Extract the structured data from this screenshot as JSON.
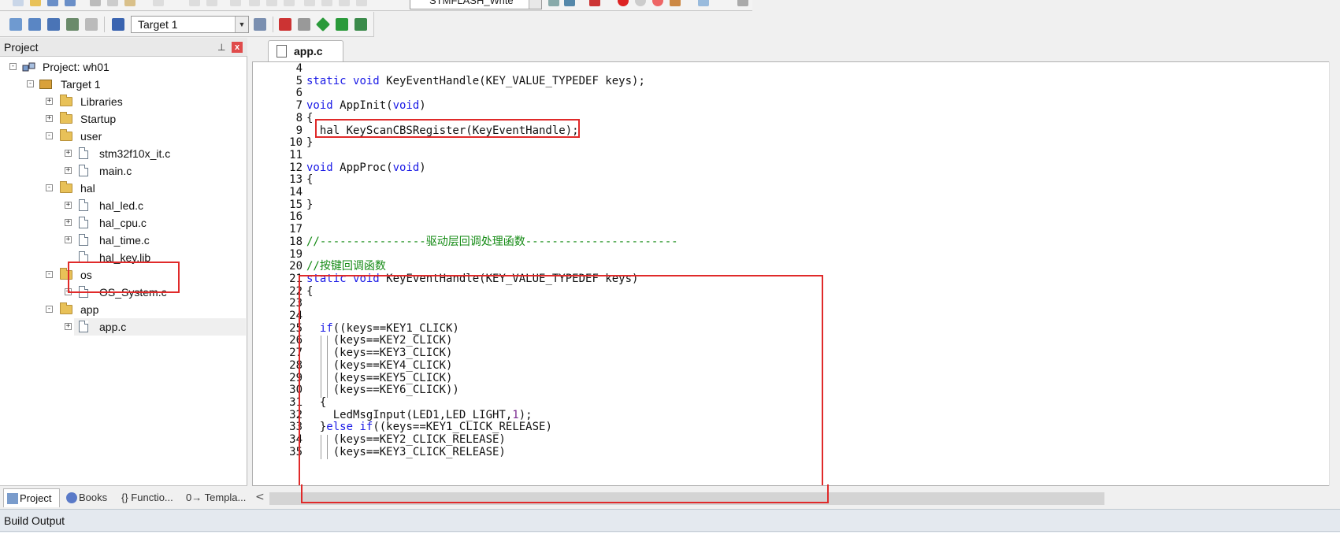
{
  "toolbar": {
    "flash_combo": "STMFLASH_Write",
    "target_combo": "Target 1"
  },
  "project_panel": {
    "title": "Project",
    "tree": [
      {
        "label": "Project: wh01",
        "level": 0,
        "kind": "project",
        "expanded": true
      },
      {
        "label": "Target 1",
        "level": 1,
        "kind": "target",
        "expanded": true
      },
      {
        "label": "Libraries",
        "level": 2,
        "kind": "folder",
        "expanded": false
      },
      {
        "label": "Startup",
        "level": 2,
        "kind": "folder",
        "expanded": false
      },
      {
        "label": "user",
        "level": 2,
        "kind": "folder",
        "expanded": true
      },
      {
        "label": "stm32f10x_it.c",
        "level": 3,
        "kind": "file"
      },
      {
        "label": "main.c",
        "level": 3,
        "kind": "file"
      },
      {
        "label": "hal",
        "level": 2,
        "kind": "folder",
        "expanded": true
      },
      {
        "label": "hal_led.c",
        "level": 3,
        "kind": "file"
      },
      {
        "label": "hal_cpu.c",
        "level": 3,
        "kind": "file"
      },
      {
        "label": "hal_time.c",
        "level": 3,
        "kind": "file"
      },
      {
        "label": "hal_key.lib",
        "level": 3,
        "kind": "file"
      },
      {
        "label": "os",
        "level": 2,
        "kind": "folder",
        "expanded": true
      },
      {
        "label": "OS_System.c",
        "level": 3,
        "kind": "file"
      },
      {
        "label": "app",
        "level": 2,
        "kind": "folder",
        "expanded": true
      },
      {
        "label": "app.c",
        "level": 3,
        "kind": "file",
        "selected": true
      }
    ],
    "bottom_tabs": [
      "Project",
      "Books",
      "{} Functio...",
      "0→ Templa..."
    ]
  },
  "editor": {
    "tab_label": "app.c",
    "lines": [
      {
        "n": "4",
        "code": ""
      },
      {
        "n": "5",
        "code": "static void KeyEventHandle(KEY_VALUE_TYPEDEF keys);"
      },
      {
        "n": "6",
        "code": ""
      },
      {
        "n": "7",
        "code": "void AppInit(void)"
      },
      {
        "n": "8",
        "code": "{"
      },
      {
        "n": "9",
        "code": "  hal_KeyScanCBSRegister(KeyEventHandle);"
      },
      {
        "n": "10",
        "code": "}"
      },
      {
        "n": "11",
        "code": ""
      },
      {
        "n": "12",
        "code": "void AppProc(void)"
      },
      {
        "n": "13",
        "code": "{"
      },
      {
        "n": "14",
        "code": ""
      },
      {
        "n": "15",
        "code": "}"
      },
      {
        "n": "16",
        "code": ""
      },
      {
        "n": "17",
        "code": ""
      },
      {
        "n": "18",
        "code": "//----------------驱动层回调处理函数-----------------------"
      },
      {
        "n": "19",
        "code": ""
      },
      {
        "n": "20",
        "code": "//按键回调函数"
      },
      {
        "n": "21",
        "code": "static void KeyEventHandle(KEY_VALUE_TYPEDEF keys)"
      },
      {
        "n": "22",
        "code": "{"
      },
      {
        "n": "23",
        "code": ""
      },
      {
        "n": "24",
        "code": ""
      },
      {
        "n": "25",
        "code": "  if((keys==KEY1_CLICK)"
      },
      {
        "n": "26",
        "code": "    (keys==KEY2_CLICK)"
      },
      {
        "n": "27",
        "code": "    (keys==KEY3_CLICK)"
      },
      {
        "n": "28",
        "code": "    (keys==KEY4_CLICK)"
      },
      {
        "n": "29",
        "code": "    (keys==KEY5_CLICK)"
      },
      {
        "n": "30",
        "code": "    (keys==KEY6_CLICK))"
      },
      {
        "n": "31",
        "code": "  {"
      },
      {
        "n": "32",
        "code": "    LedMsgInput(LED1,LED_LIGHT,1);"
      },
      {
        "n": "33",
        "code": "  }else if((keys==KEY1_CLICK_RELEASE)"
      },
      {
        "n": "34",
        "code": "    (keys==KEY2_CLICK_RELEASE)"
      },
      {
        "n": "35",
        "code": "    (keys==KEY3_CLICK_RELEASE)"
      }
    ]
  },
  "build_output": {
    "title": "Build Output"
  },
  "colors": {
    "keyword": "#1a1ae6",
    "comment": "#138a13",
    "highlight_box": "#e02a2a"
  }
}
